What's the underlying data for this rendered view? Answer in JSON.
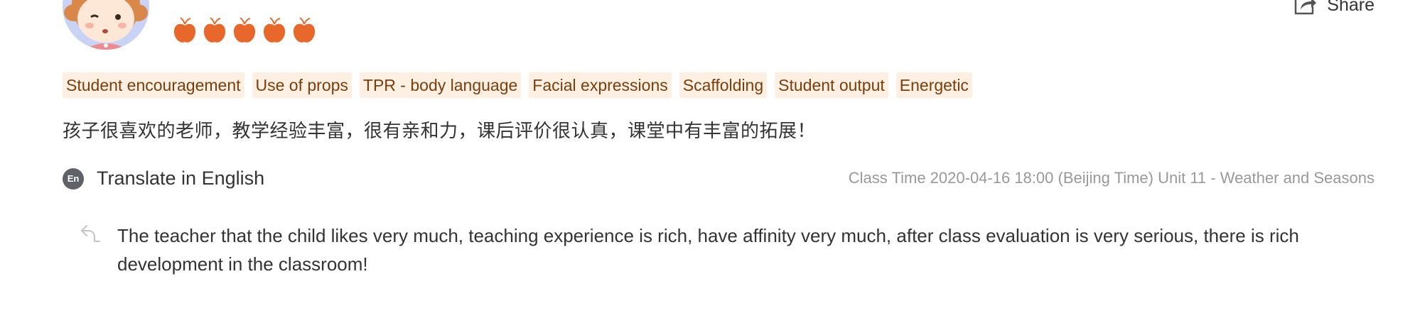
{
  "rating": {
    "value": 5,
    "max": 5,
    "icon": "apple-icon",
    "color": "#e8672b"
  },
  "share": {
    "label": "Share",
    "icon": "share-icon"
  },
  "tags": [
    "Student encouragement",
    "Use of props",
    "TPR - body language",
    "Facial expressions",
    "Scaffolding",
    "Student output",
    "Energetic"
  ],
  "colors": {
    "tag_bg": "#fdf0e3",
    "tag_text": "#7a3e0a",
    "muted_text": "#999999"
  },
  "review": {
    "text": "孩子很喜欢的老师，教学经验丰富，很有亲和力，课后评价很认真，课堂中有丰富的拓展！"
  },
  "translate": {
    "icon_text": "En",
    "label": "Translate in English"
  },
  "class_info": {
    "text": "Class Time 2020-04-16 18:00 (Beijing Time) Unit 11 - Weather and Seasons"
  },
  "translation": {
    "text": "The teacher that the child likes very much, teaching experience is rich, have affinity very much, after class evaluation is very serious, there is rich development in the classroom!"
  }
}
